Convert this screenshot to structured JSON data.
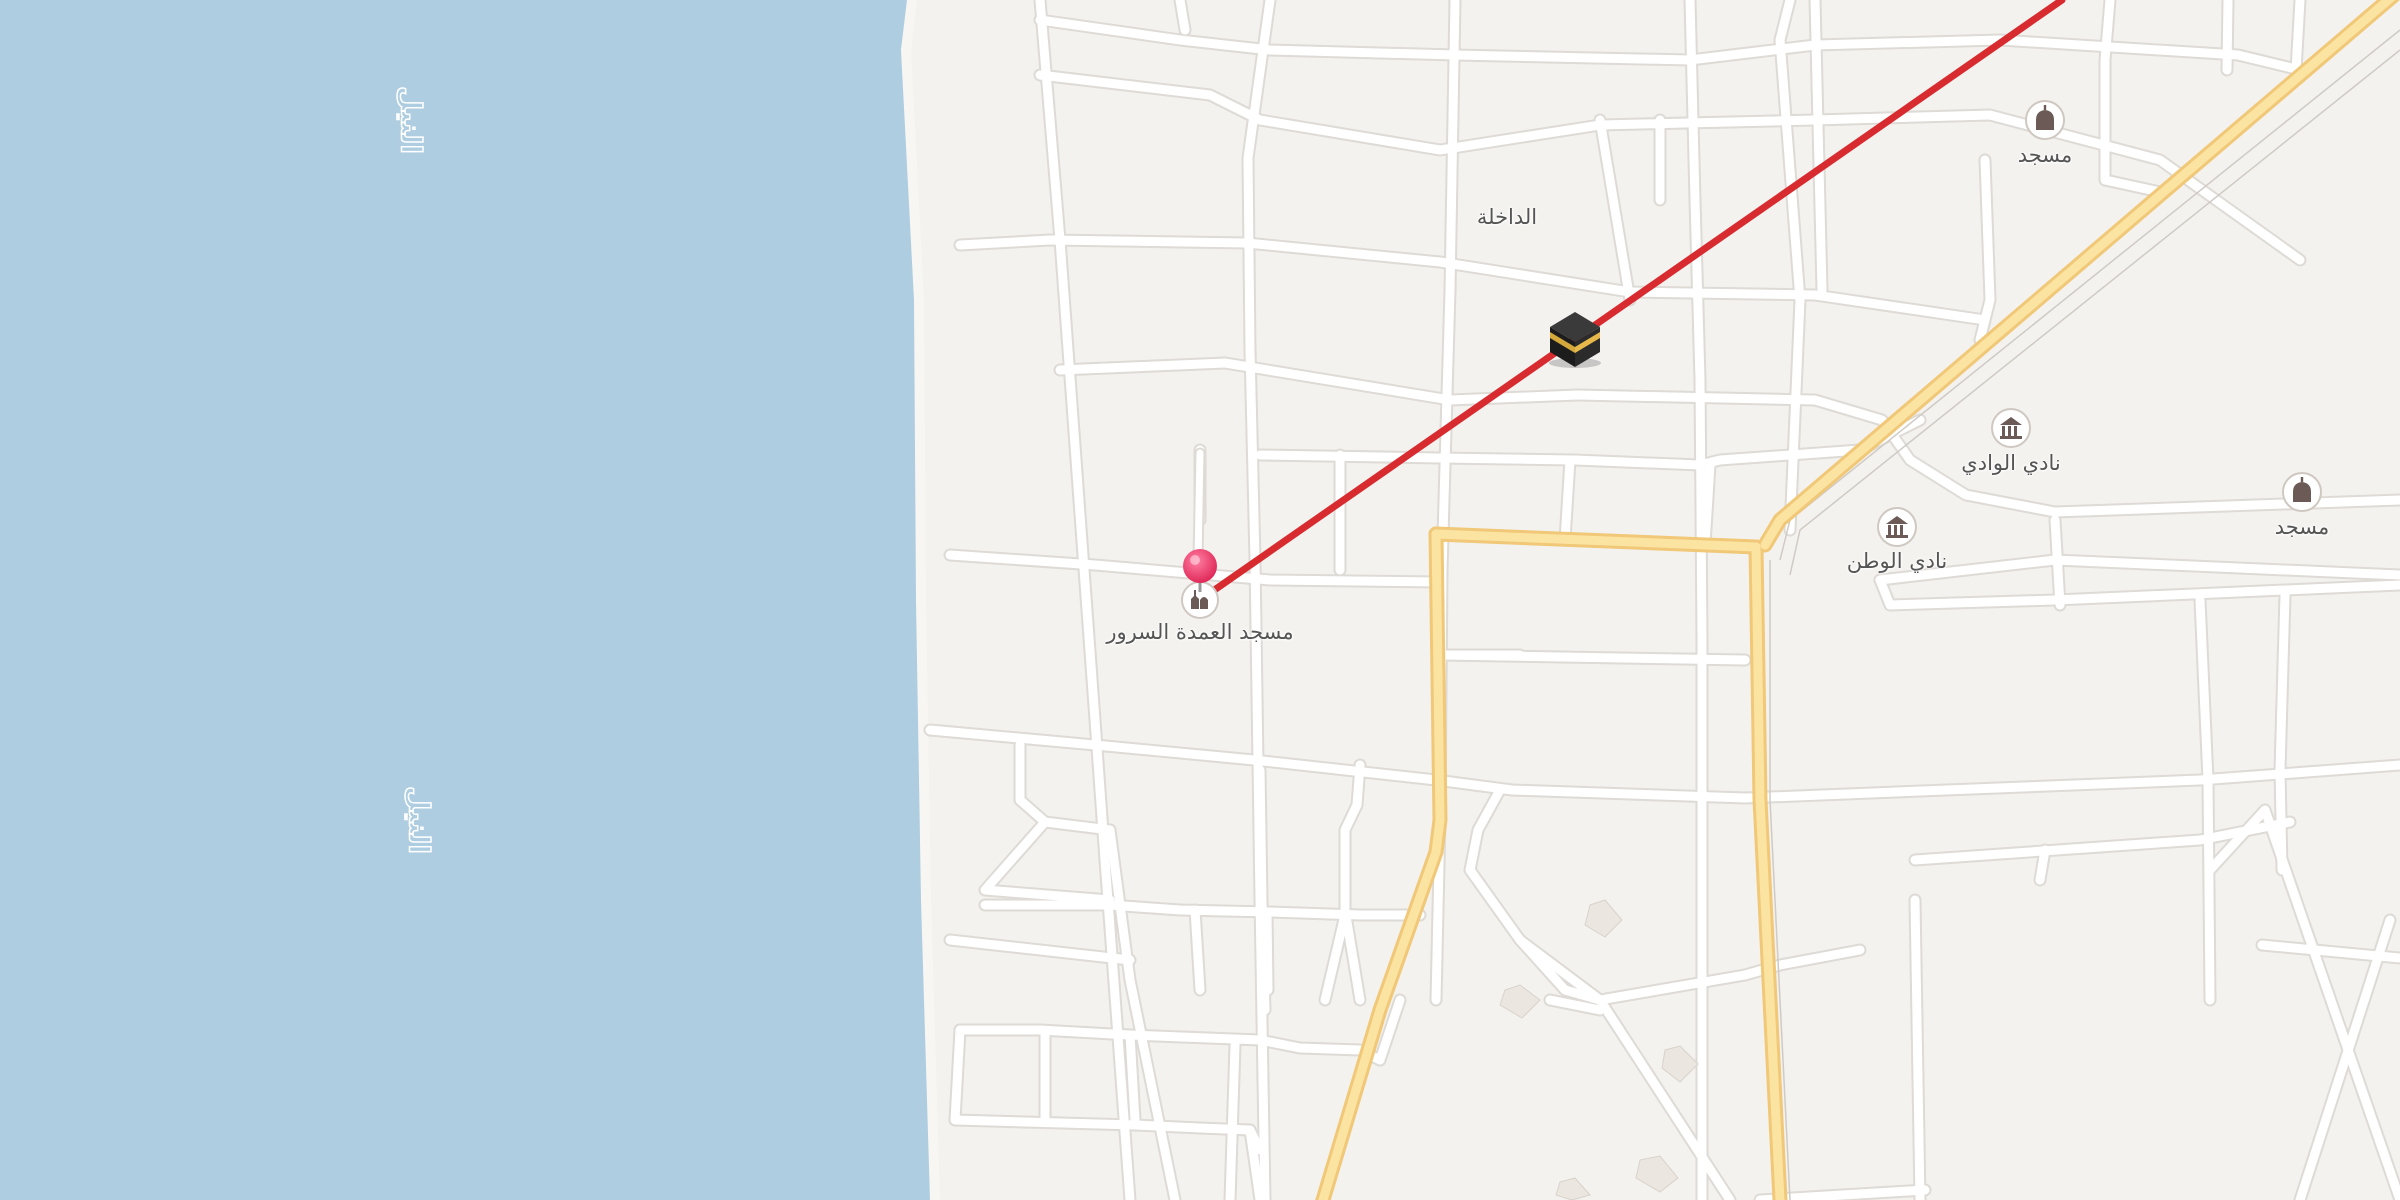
{
  "map": {
    "water_labels": [
      "النيل",
      "النيل"
    ],
    "area_label": "الداخلة",
    "poi": {
      "pinned_mosque": "مسجد العمدة السرور",
      "mosque_north": "مسجد",
      "mosque_east": "مسجد",
      "club_wadi": "نادي الوادي",
      "club_watan": "نادي الوطن"
    },
    "qibla_marker": "kaaba-icon",
    "colors": {
      "water": "#aecde1",
      "land": "#f4f2ef",
      "street": "#ffffff",
      "street_casing": "#dedad5",
      "major_road": "#fbe3a2",
      "major_road_casing": "#f0c878",
      "qibla_line": "#d72b30",
      "pin": "#e8305f",
      "poi_icon": "#6b5a55"
    }
  }
}
